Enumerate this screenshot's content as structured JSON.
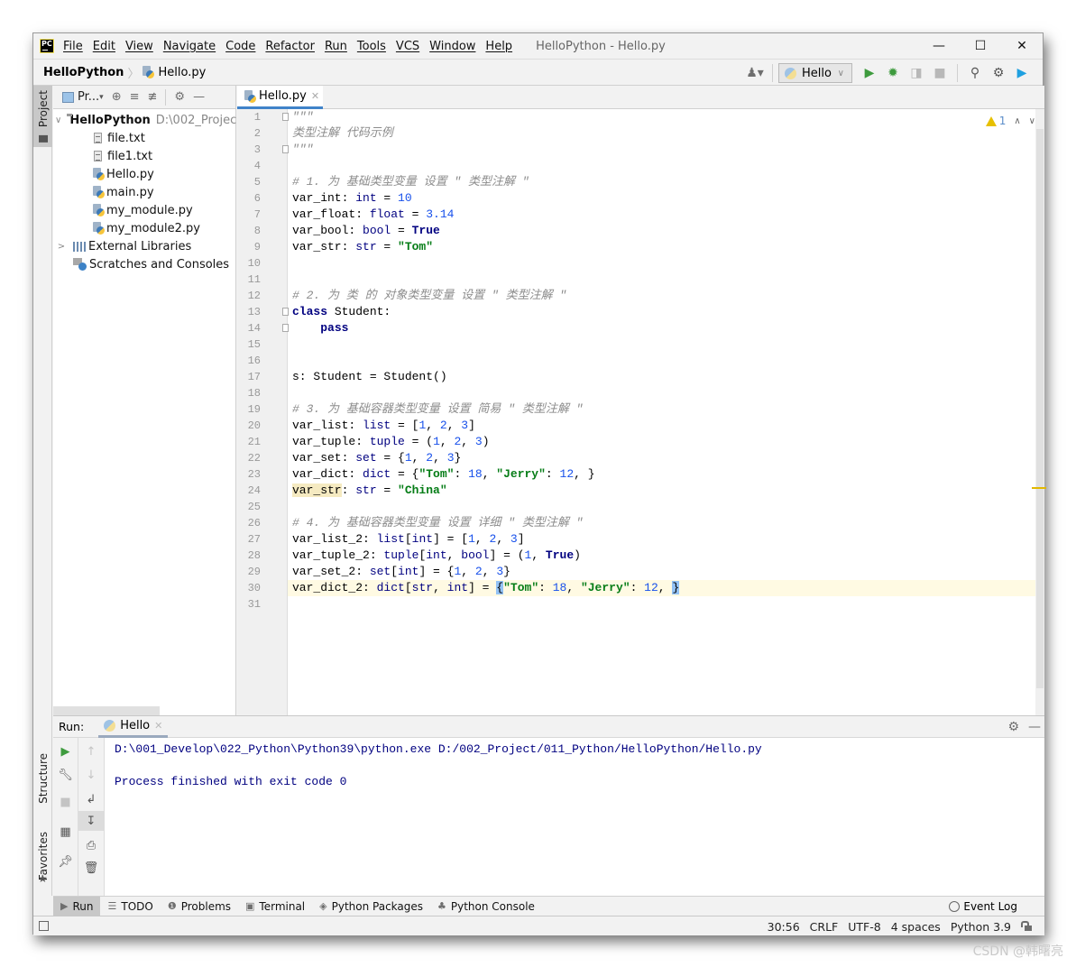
{
  "window": {
    "title": "HelloPython - Hello.py",
    "app_logo": "PC",
    "menu": [
      "File",
      "Edit",
      "View",
      "Navigate",
      "Code",
      "Refactor",
      "Run",
      "Tools",
      "VCS",
      "Window",
      "Help"
    ],
    "controls": {
      "minimize": "—",
      "maximize": "☐",
      "close": "✕"
    }
  },
  "navbar": {
    "project": "HelloPython",
    "separator": "〉",
    "file": "Hello.py",
    "run_config": "Hello",
    "icons": [
      "user-icon",
      "run-icon",
      "debug-icon",
      "coverage-icon",
      "stop-icon",
      "search-icon",
      "settings-icon",
      "jetbrains-toolbox-icon"
    ]
  },
  "left_stripe": {
    "project_label": "Project",
    "structure_label": "Structure",
    "favorites_label": "Favorites"
  },
  "project_panel": {
    "view_label": "Pr...",
    "root": {
      "name": "HelloPython",
      "path": "D:\\002_Projec"
    },
    "files": [
      {
        "name": "file.txt",
        "type": "txt"
      },
      {
        "name": "file1.txt",
        "type": "txt"
      },
      {
        "name": "Hello.py",
        "type": "py"
      },
      {
        "name": "main.py",
        "type": "py"
      },
      {
        "name": "my_module.py",
        "type": "py"
      },
      {
        "name": "my_module2.py",
        "type": "py"
      }
    ],
    "external_libraries": "External Libraries",
    "scratches": "Scratches and Consoles"
  },
  "editor": {
    "tab": "Hello.py",
    "warnings_count": "1",
    "current_line": 30,
    "lines": [
      "\"\"\"",
      "类型注解 代码示例",
      "\"\"\"",
      "",
      "# 1. 为 基础类型变量 设置 \" 类型注解 \"",
      "var_int: int = 10",
      "var_float: float = 3.14",
      "var_bool: bool = True",
      "var_str: str = \"Tom\"",
      "",
      "",
      "# 2. 为 类 的 对象类型变量 设置 \" 类型注解 \"",
      "class Student:",
      "    pass",
      "",
      "",
      "s: Student = Student()",
      "",
      "# 3. 为 基础容器类型变量 设置 简易 \" 类型注解 \"",
      "var_list: list = [1, 2, 3]",
      "var_tuple: tuple = (1, 2, 3)",
      "var_set: set = {1, 2, 3}",
      "var_dict: dict = {\"Tom\": 18, \"Jerry\": 12, }",
      "var_str: str = \"China\"",
      "",
      "# 4. 为 基础容器类型变量 设置 详细 \" 类型注解 \"",
      "var_list_2: list[int] = [1, 2, 3]",
      "var_tuple_2: tuple[int, bool] = (1, True)",
      "var_set_2: set[int] = {1, 2, 3}",
      "var_dict_2: dict[str, int] = {\"Tom\": 18, \"Jerry\": 12, }",
      ""
    ]
  },
  "run_panel": {
    "label": "Run:",
    "tab": "Hello",
    "output": [
      "D:\\001_Develop\\022_Python\\Python39\\python.exe D:/002_Project/011_Python/HelloPython/Hello.py",
      "",
      "Process finished with exit code 0"
    ]
  },
  "tool_windows": [
    {
      "label": "Run",
      "icon": "▶",
      "active": true
    },
    {
      "label": "TODO",
      "icon": "☰"
    },
    {
      "label": "Problems",
      "icon": "❶"
    },
    {
      "label": "Terminal",
      "icon": "▣"
    },
    {
      "label": "Python Packages",
      "icon": "◈"
    },
    {
      "label": "Python Console",
      "icon": "♣"
    }
  ],
  "event_log": "Event Log",
  "status_bar": {
    "position": "30:56",
    "line_separator": "CRLF",
    "encoding": "UTF-8",
    "indent": "4 spaces",
    "interpreter": "Python 3.9"
  },
  "watermark": "CSDN @韩曙亮"
}
